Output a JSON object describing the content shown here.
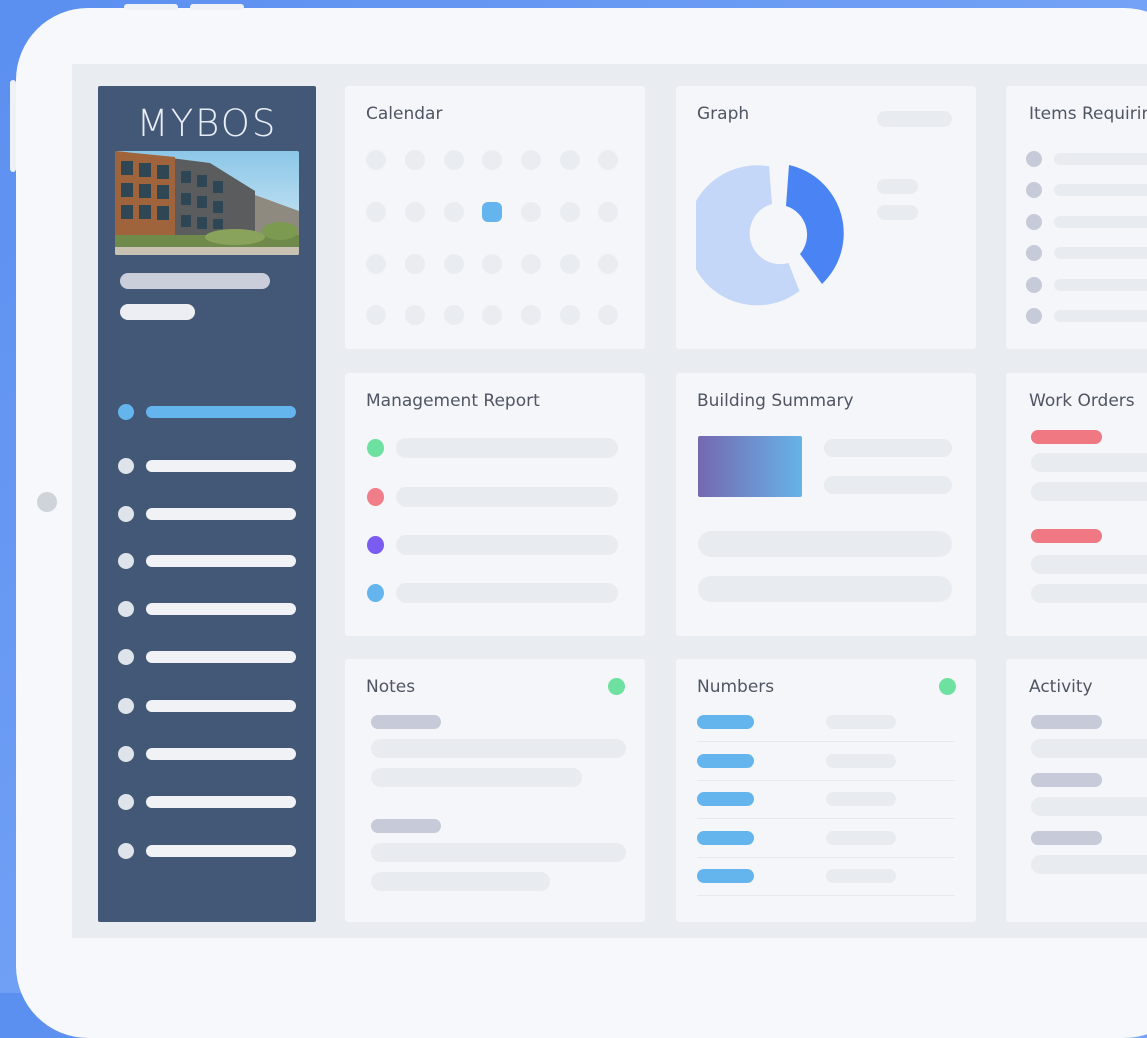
{
  "app": {
    "logo": "MYBOS",
    "accent": "#64b5ee",
    "sidebar_bg": "#435877"
  },
  "sidebar": {
    "photo_icon": "building-photo",
    "nav_count": 9,
    "active_index": 0
  },
  "cards": {
    "calendar": {
      "title": "Calendar",
      "highlight_color": "#64b5ee"
    },
    "graph": {
      "title": "Graph",
      "donut_colors": [
        "#c4d7f8",
        "#4a84f4"
      ]
    },
    "items": {
      "title": "Items Requirin"
    },
    "management": {
      "title": "Management Report",
      "status_colors": [
        "#6ee0a0",
        "#f07e88",
        "#7b5cf0",
        "#64b5ee"
      ]
    },
    "building": {
      "title": "Building Summary"
    },
    "work_orders": {
      "title": "Work Orders",
      "tag_color": "#f07883"
    },
    "notes": {
      "title": "Notes",
      "status_color": "#6ee0a0"
    },
    "numbers": {
      "title": "Numbers",
      "status_color": "#6ee0a0"
    },
    "activity": {
      "title": "Activity"
    }
  }
}
